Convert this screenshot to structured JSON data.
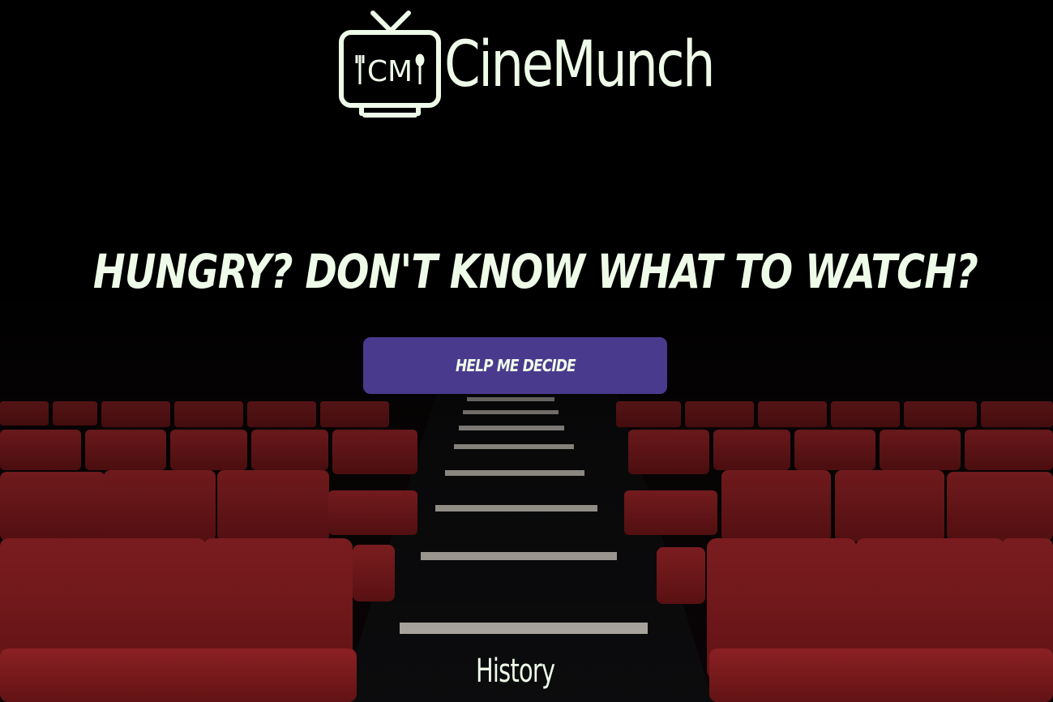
{
  "brand": {
    "name": "CineMunch",
    "logo_letters": "CM",
    "logo_icon": "tv-icon"
  },
  "hero": {
    "headline": "HUNGRY? DON'T KNOW WHAT TO WATCH?",
    "cta_label": "HELP ME DECIDE"
  },
  "nav": {
    "history_label": "History"
  },
  "colors": {
    "text": "#eefbe9",
    "button": "#4a3a8e",
    "background": "#000000",
    "seat": "#8e1f22"
  }
}
